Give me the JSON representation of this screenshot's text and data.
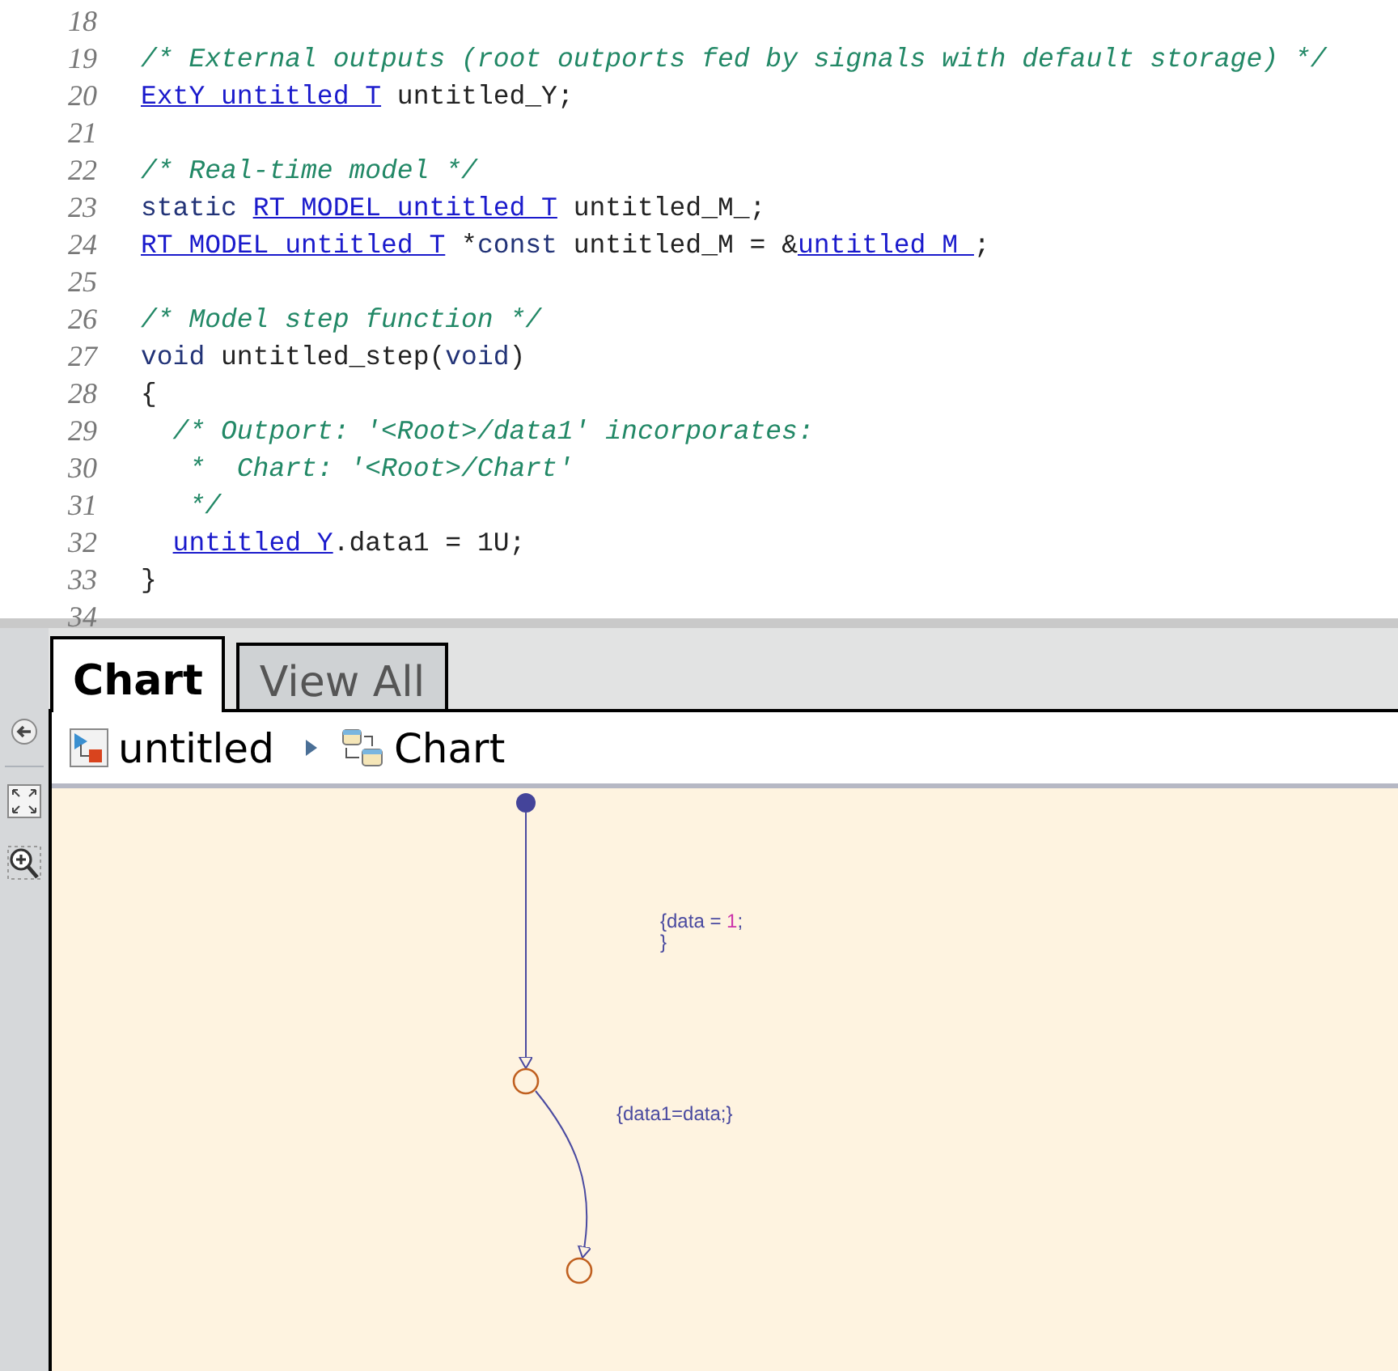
{
  "code": {
    "lines": [
      {
        "number": "18"
      },
      {
        "number": "19",
        "tokens": [
          {
            "kind": "comment",
            "text": "/* External outputs (root outports fed by signals with default storage) */"
          }
        ]
      },
      {
        "number": "20",
        "tokens": [
          {
            "kind": "link",
            "text": "ExtY_untitled_T"
          },
          {
            "kind": "plain",
            "text": " untitled_Y;"
          }
        ]
      },
      {
        "number": "21"
      },
      {
        "number": "22",
        "tokens": [
          {
            "kind": "comment",
            "text": "/* Real-time model */"
          }
        ]
      },
      {
        "number": "23",
        "tokens": [
          {
            "kind": "keyword",
            "text": "static "
          },
          {
            "kind": "link",
            "text": "RT_MODEL_untitled_T"
          },
          {
            "kind": "plain",
            "text": " untitled_M_;"
          }
        ]
      },
      {
        "number": "24",
        "tokens": [
          {
            "kind": "link",
            "text": "RT_MODEL_untitled_T"
          },
          {
            "kind": "plain",
            "text": " *"
          },
          {
            "kind": "keyword",
            "text": "const"
          },
          {
            "kind": "plain",
            "text": " untitled_M = &"
          },
          {
            "kind": "link",
            "text": "untitled_M_"
          },
          {
            "kind": "plain",
            "text": ";"
          }
        ]
      },
      {
        "number": "25"
      },
      {
        "number": "26",
        "tokens": [
          {
            "kind": "comment",
            "text": "/* Model step function */"
          }
        ]
      },
      {
        "number": "27",
        "tokens": [
          {
            "kind": "keyword",
            "text": "void"
          },
          {
            "kind": "plain",
            "text": " untitled_step("
          },
          {
            "kind": "keyword",
            "text": "void"
          },
          {
            "kind": "plain",
            "text": ")"
          }
        ]
      },
      {
        "number": "28",
        "tokens": [
          {
            "kind": "plain",
            "text": "{"
          }
        ]
      },
      {
        "number": "29",
        "indented": true,
        "tokens": [
          {
            "kind": "comment",
            "text": "/* Outport: '<Root>/data1' incorporates:"
          }
        ]
      },
      {
        "number": "30",
        "tokens": [
          {
            "kind": "comment",
            "text": "   *  Chart: '<Root>/Chart'"
          }
        ]
      },
      {
        "number": "31",
        "tokens": [
          {
            "kind": "comment",
            "text": "   */"
          }
        ]
      },
      {
        "number": "32",
        "indented": true,
        "tokens": [
          {
            "kind": "link",
            "text": "untitled_Y"
          },
          {
            "kind": "plain",
            "text": ".data1 = 1U;"
          }
        ]
      },
      {
        "number": "33",
        "tokens": [
          {
            "kind": "plain",
            "text": "}"
          }
        ]
      },
      {
        "number": "34"
      }
    ]
  },
  "tabs": [
    {
      "label": "Chart",
      "selected": true
    },
    {
      "label": "View All",
      "selected": false
    }
  ],
  "breadcrumb": [
    {
      "label": "untitled",
      "kind": "model"
    },
    {
      "label": "Chart",
      "kind": "chart"
    }
  ],
  "diagram": {
    "labels": [
      [
        [
          {
            "kind": "plain",
            "text": "{data = "
          },
          {
            "kind": "number",
            "text": "1"
          },
          {
            "kind": "plain",
            "text": ";"
          }
        ],
        [
          {
            "kind": "plain",
            "text": "}"
          }
        ]
      ],
      [
        [
          {
            "kind": "plain",
            "text": "{data1=data;}"
          }
        ]
      ]
    ]
  }
}
